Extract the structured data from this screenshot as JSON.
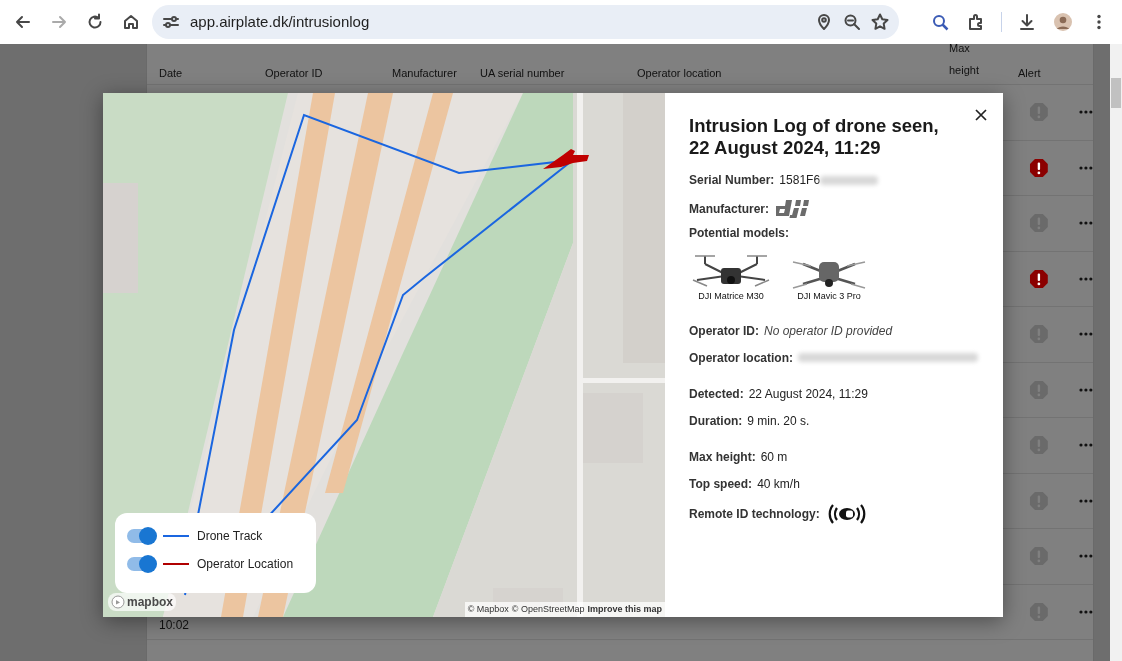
{
  "browser": {
    "url": "app.airplate.dk/intrusionlog"
  },
  "table": {
    "columns": [
      {
        "label": "Date"
      },
      {
        "label": "Operator ID"
      },
      {
        "label": "Manufacturer"
      },
      {
        "label": "UA serial number"
      },
      {
        "label": "Operator location"
      },
      {
        "label": "Max height"
      },
      {
        "label": "Alert"
      }
    ],
    "rows": [
      {
        "alert": false
      },
      {
        "alert": true
      },
      {
        "alert": false
      },
      {
        "alert": true
      },
      {
        "alert": false
      },
      {
        "alert": false
      },
      {
        "alert": false
      },
      {
        "alert": false
      },
      {
        "alert": false
      },
      {
        "alert": false,
        "date": "10:02"
      }
    ]
  },
  "modal": {
    "title": "Intrusion Log of drone seen, 22 August 2024, 11:29",
    "serial": {
      "label": "Serial Number:",
      "value": "1581F6"
    },
    "manufacturer": {
      "label": "Manufacturer:"
    },
    "models": {
      "label": "Potential models:",
      "items": [
        {
          "name": "DJI Matrice M30"
        },
        {
          "name": "DJI Mavic 3 Pro"
        }
      ]
    },
    "operator_id": {
      "label": "Operator ID:",
      "value": "No operator ID provided"
    },
    "operator_location": {
      "label": "Operator location:"
    },
    "detected": {
      "label": "Detected:",
      "value": "22 August 2024, 11:29"
    },
    "duration": {
      "label": "Duration:",
      "value": "9 min. 20 s."
    },
    "max_height": {
      "label": "Max height:",
      "value": "60 m"
    },
    "top_speed": {
      "label": "Top speed:",
      "value": "40 km/h"
    },
    "remote_id": {
      "label": "Remote ID technology:"
    }
  },
  "map": {
    "legend": [
      {
        "label": "Drone Track",
        "on": true,
        "color": "#1a66e0"
      },
      {
        "label": "Operator Location",
        "on": true,
        "color": "#b00000"
      }
    ],
    "logo": "mapbox",
    "attribution": [
      {
        "text": "© Mapbox"
      },
      {
        "text": "© OpenStreetMap"
      },
      {
        "text": "Improve this map"
      }
    ]
  }
}
